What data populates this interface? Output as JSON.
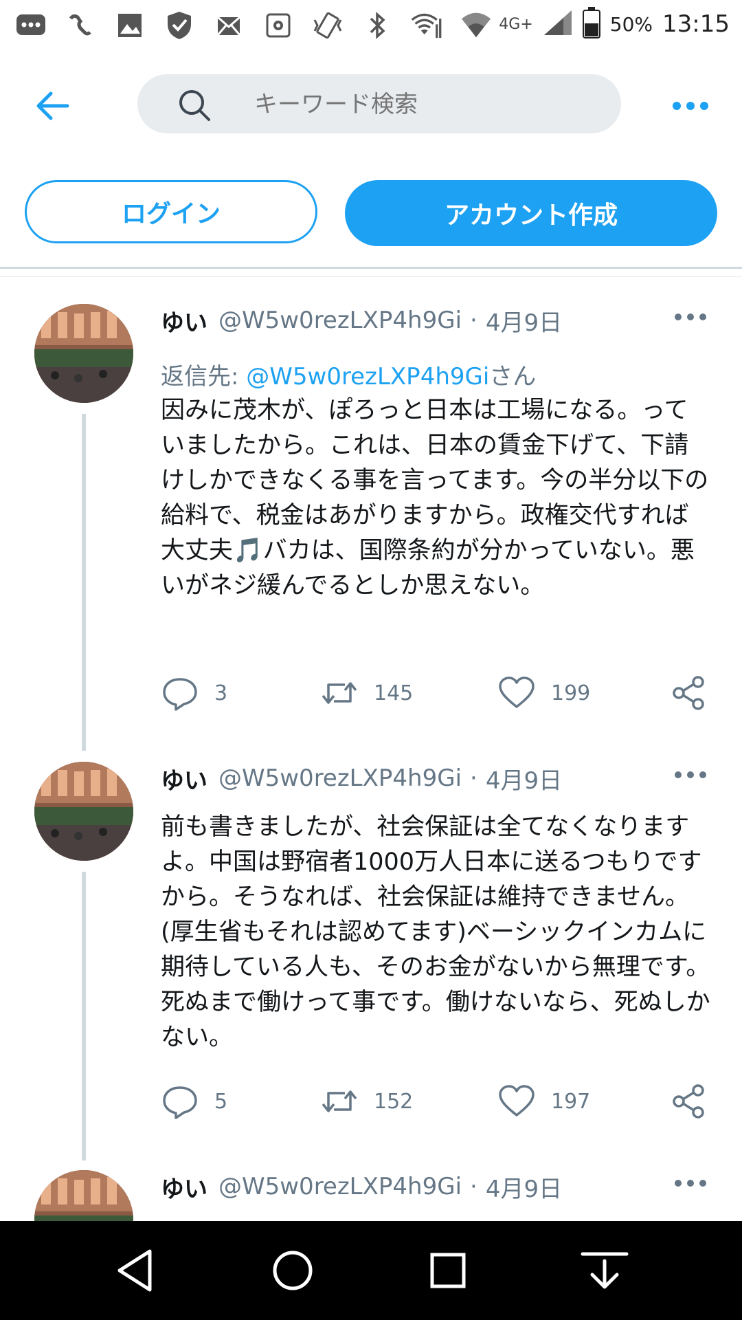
{
  "status_bar": {
    "network": "4G+",
    "battery": "50%",
    "time": "13:15"
  },
  "search": {
    "placeholder": "キーワード検索"
  },
  "auth": {
    "login_label": "ログイン",
    "signup_label": "アカウント作成"
  },
  "colors": {
    "accent": "#1da1f2",
    "text": "#14171a",
    "muted": "#657786"
  },
  "tweets": [
    {
      "name": "ゆい",
      "handle": "@W5w0rezLXP4h9Gi",
      "separator": "·",
      "date": "4月9日",
      "reply_prefix": "返信先: ",
      "reply_to": "@W5w0rezLXP4h9Gi",
      "reply_suffix": "さん",
      "body": "因みに茂木が、ぽろっと日本は工場になる。っていましたから。これは、日本の賃金下げて、下請けしかできなくる事を言ってます。今の半分以下の給料で、税金はあがりますから。政権交代すれば大丈夫🎵バカは、国際条約が分かっていない。悪いがネジ緩んでるとしか思えない。",
      "replies": "3",
      "retweets": "145",
      "likes": "199"
    },
    {
      "name": "ゆい",
      "handle": "@W5w0rezLXP4h9Gi",
      "separator": "·",
      "date": "4月9日",
      "body": "前も書きましたが、社会保証は全てなくなりますよ。中国は野宿者1000万人日本に送るつもりですから。そうなれば、社会保証は維持できません。(厚生省もそれは認めてます)ベーシックインカムに期待している人も、そのお金がないから無理です。死ぬまで働けって事です。働けないなら、死ぬしかない。",
      "replies": "5",
      "retweets": "152",
      "likes": "197"
    },
    {
      "name": "ゆい",
      "handle": "@W5w0rezLXP4h9Gi",
      "separator": "·",
      "date": "4月9日"
    }
  ]
}
